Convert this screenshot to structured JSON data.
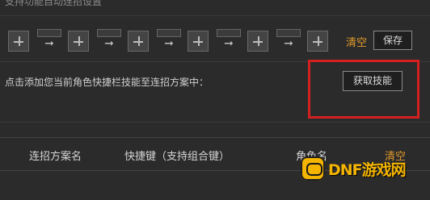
{
  "top_caption": "支持功能自动连招设置",
  "combo": {
    "slot_icon": "plus-icon",
    "arrow_icon": "arrow-right-icon",
    "clear_label": "清空",
    "save_label": "保存"
  },
  "instruction": "点击添加您当前角色快捷栏技能至连招方案中：",
  "fetch_skills_label": "获取技能",
  "table": {
    "columns": [
      "连招方案名",
      "快捷键（支持组合键）",
      "角色名",
      "清空"
    ]
  },
  "watermark": {
    "text": "DNF游戏网",
    "icon": "gamepad-icon",
    "color": "#f4b400"
  },
  "colors": {
    "accent": "#e19a2a",
    "highlight": "#d32020",
    "background": "#2b2b2b"
  }
}
